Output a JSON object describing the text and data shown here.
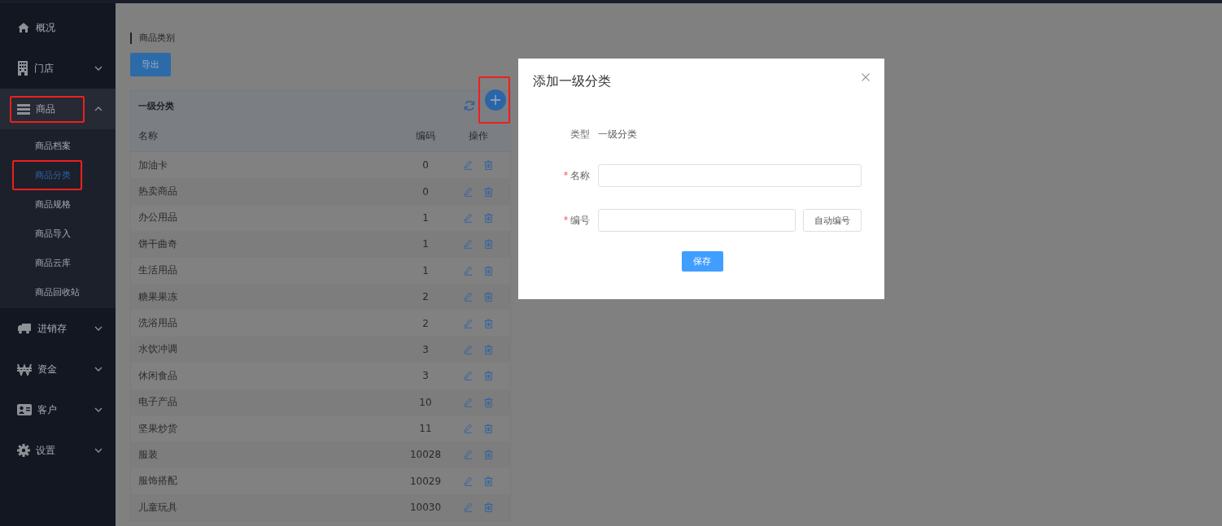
{
  "sidebar": {
    "items": [
      {
        "label": "概况",
        "kind": "home",
        "chevron": false,
        "expanded": false,
        "highlighted": false
      },
      {
        "label": "门店",
        "kind": "building",
        "chevron": true,
        "expanded": false,
        "highlighted": false
      },
      {
        "label": "商品",
        "kind": "list",
        "chevron": true,
        "expanded": true,
        "highlighted": true,
        "children": [
          {
            "label": "商品档案",
            "selected": false,
            "highlighted": false
          },
          {
            "label": "商品分类",
            "selected": true,
            "highlighted": true
          },
          {
            "label": "商品规格",
            "selected": false,
            "highlighted": false
          },
          {
            "label": "商品导入",
            "selected": false,
            "highlighted": false
          },
          {
            "label": "商品云库",
            "selected": false,
            "highlighted": false
          },
          {
            "label": "商品回收站",
            "selected": false,
            "highlighted": false
          }
        ]
      },
      {
        "label": "进销存",
        "kind": "truck",
        "chevron": true,
        "expanded": false,
        "highlighted": false
      },
      {
        "label": "资金",
        "kind": "won",
        "chevron": true,
        "expanded": false,
        "highlighted": false
      },
      {
        "label": "客户",
        "kind": "card",
        "chevron": true,
        "expanded": false,
        "highlighted": false
      },
      {
        "label": "设置",
        "kind": "gear",
        "chevron": true,
        "expanded": false,
        "highlighted": false
      }
    ]
  },
  "page": {
    "title": "商品类别",
    "export_button": "导出"
  },
  "category_panel": {
    "title": "一级分类",
    "add_highlighted": true,
    "columns": [
      "名称",
      "编码",
      "操作"
    ],
    "rows": [
      {
        "name": "加油卡",
        "code": "0"
      },
      {
        "name": "热卖商品",
        "code": "0"
      },
      {
        "name": "办公用品",
        "code": "1"
      },
      {
        "name": "饼干曲奇",
        "code": "1"
      },
      {
        "name": "生活用品",
        "code": "1"
      },
      {
        "name": "糖果果冻",
        "code": "2"
      },
      {
        "name": "洗浴用品",
        "code": "2"
      },
      {
        "name": "水饮冲调",
        "code": "3"
      },
      {
        "name": "休闲食品",
        "code": "3"
      },
      {
        "name": "电子产品",
        "code": "10"
      },
      {
        "name": "坚果炒货",
        "code": "11"
      },
      {
        "name": "服装",
        "code": "10028"
      },
      {
        "name": "服饰搭配",
        "code": "10029"
      },
      {
        "name": "儿童玩具",
        "code": "10030"
      }
    ]
  },
  "dialog": {
    "title": "添加一级分类",
    "type_label": "类型",
    "type_value": "一级分类",
    "fields": [
      {
        "label": "名称",
        "required": true,
        "kind": "text"
      },
      {
        "label": "编号",
        "required": true,
        "kind": "auto",
        "button": "自动编号"
      }
    ],
    "save_button": "保存"
  }
}
